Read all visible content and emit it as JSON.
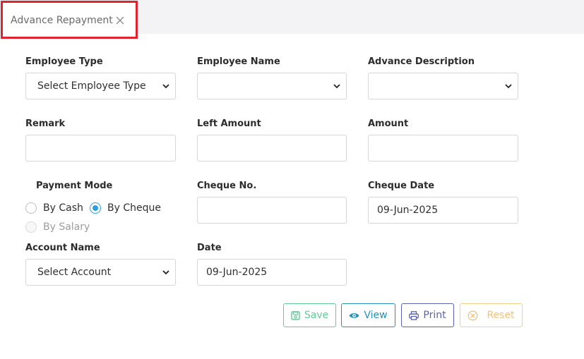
{
  "tab": {
    "label": "Advance Repayment"
  },
  "form": {
    "employee_type": {
      "label": "Employee Type",
      "value": "Select Employee Type"
    },
    "employee_name": {
      "label": "Employee Name",
      "value": ""
    },
    "advance_description": {
      "label": "Advance Description",
      "value": ""
    },
    "remark": {
      "label": "Remark",
      "value": ""
    },
    "left_amount": {
      "label": "Left Amount",
      "value": ""
    },
    "amount": {
      "label": "Amount",
      "value": ""
    },
    "payment_mode": {
      "label": "Payment Mode",
      "options": [
        "By Cash",
        "By Cheque",
        "By Salary"
      ],
      "selected": "By Cheque"
    },
    "cheque_no": {
      "label": "Cheque No.",
      "value": ""
    },
    "cheque_date": {
      "label": "Cheque Date",
      "value": "09-Jun-2025"
    },
    "account_name": {
      "label": "Account Name",
      "value": "Select Account"
    },
    "date": {
      "label": "Date",
      "value": "09-Jun-2025"
    }
  },
  "buttons": {
    "save": "Save",
    "view": "View",
    "print": "Print",
    "reset": "Reset"
  },
  "colors": {
    "tab_highlight": "#e0242d",
    "radio_selected": "#2aa0e0",
    "save": "#5fce98",
    "view": "#2593b4",
    "print": "#5a62b8",
    "reset": "#f5c07a"
  }
}
